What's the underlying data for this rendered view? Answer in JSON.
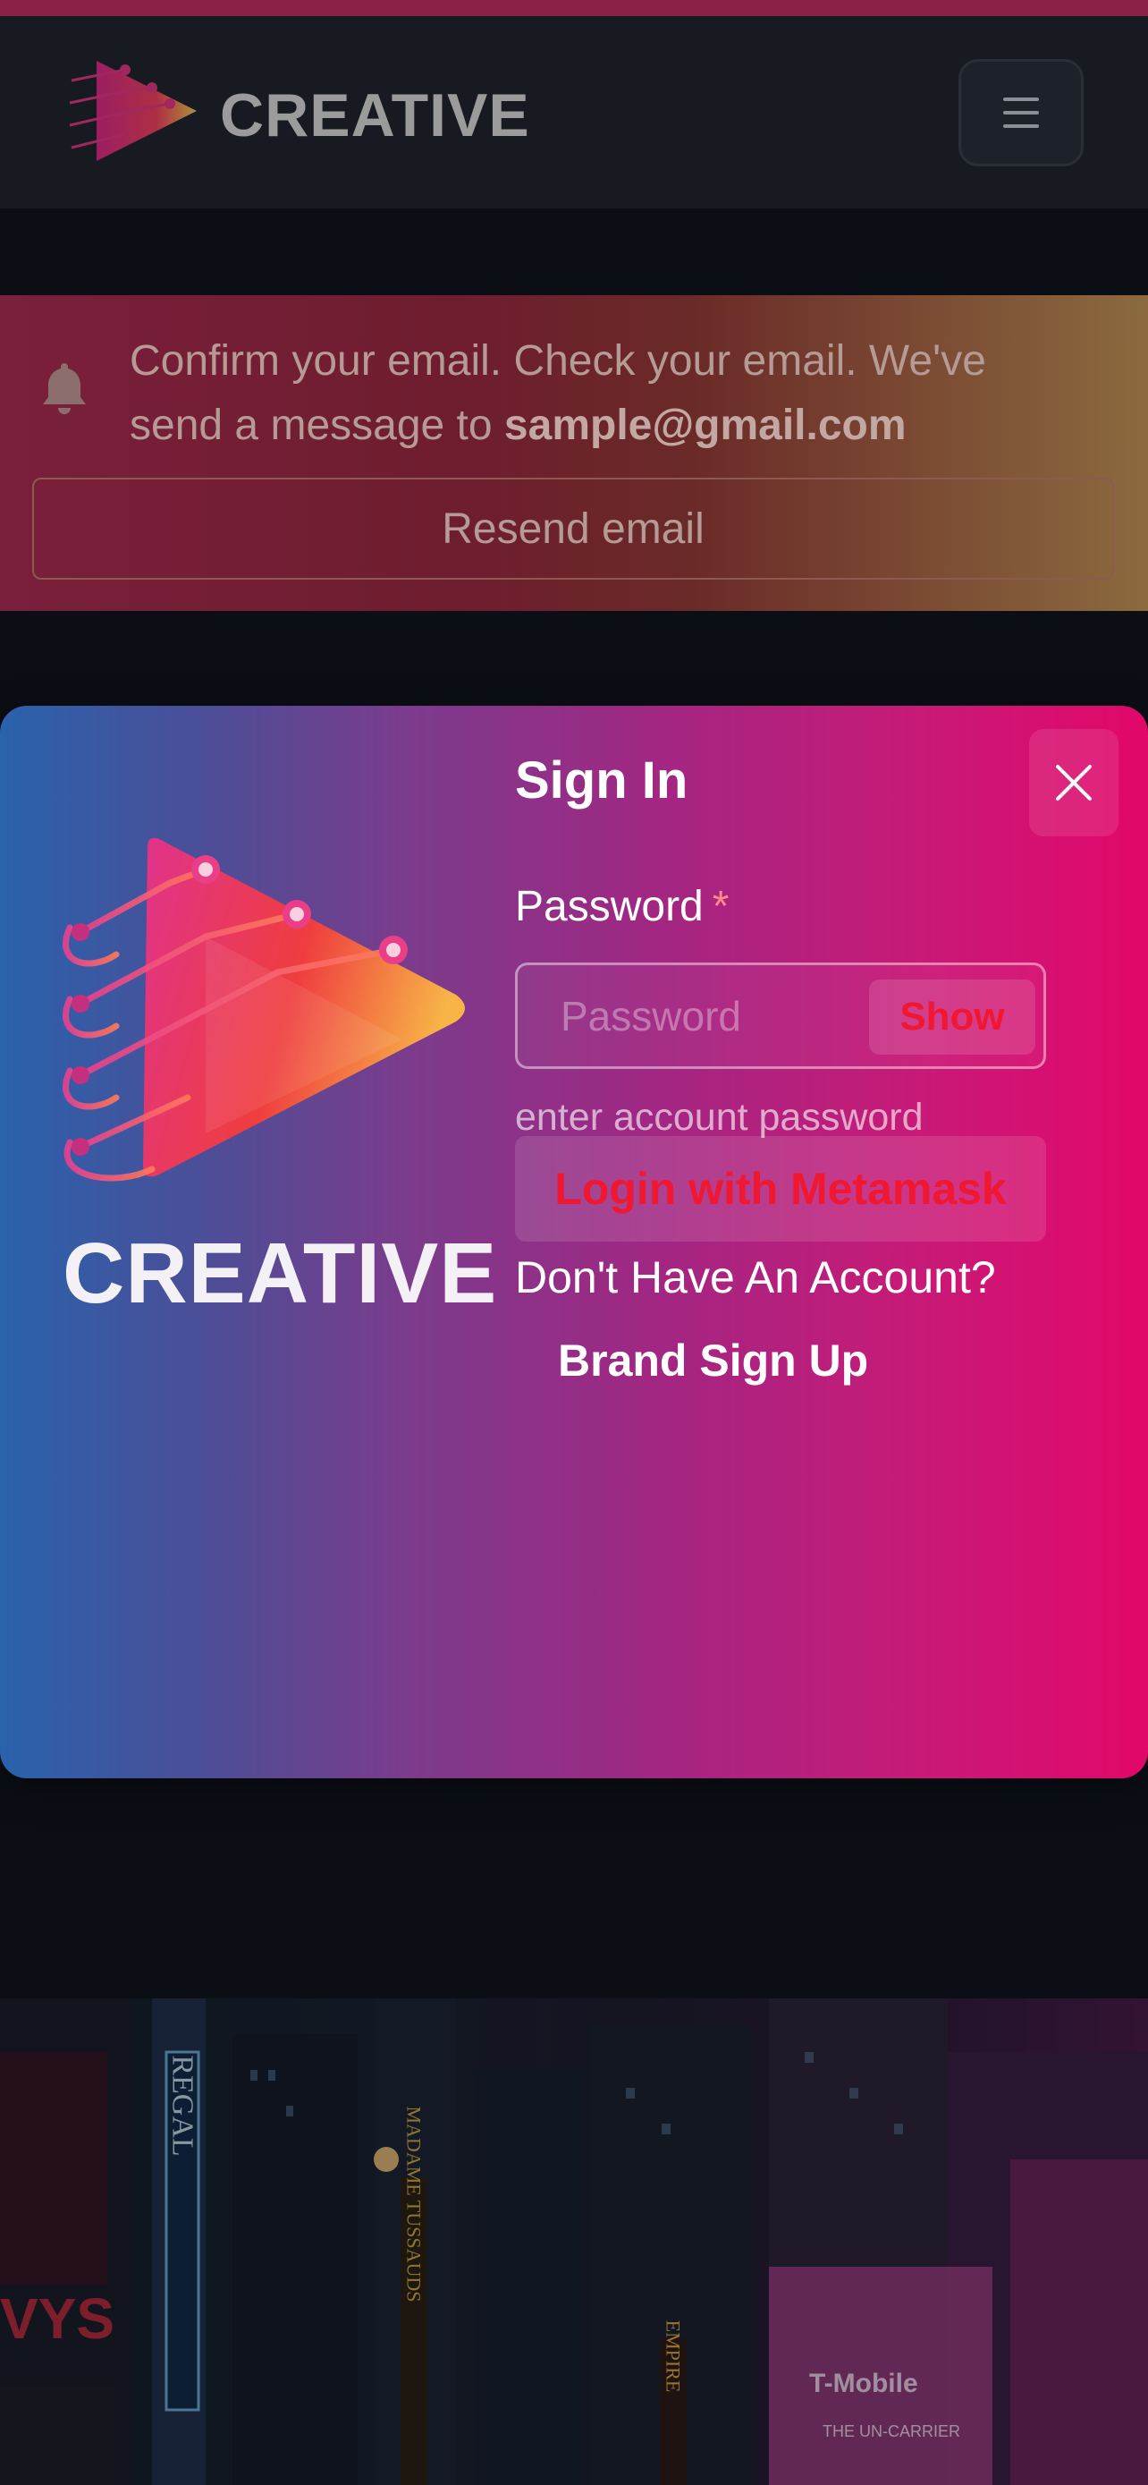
{
  "header": {
    "brand": "CREATIVE",
    "menu_icon": "hamburger-menu-icon"
  },
  "alert": {
    "icon": "bell-icon",
    "message": "Confirm your email. Check your email. We've send a message to ",
    "email": "sample@gmail.com",
    "resend_label": "Resend email"
  },
  "modal": {
    "brand": "CREATIVE",
    "title": "Sign In",
    "close_icon": "close-icon",
    "password_label": "Password",
    "required_marker": "*",
    "password_placeholder": "Password",
    "password_value": "",
    "show_label": "Show",
    "password_help": "enter account password",
    "metamask_label": "Login with Metamask",
    "no_account_text": "Don't Have An Account?",
    "signup_label": "Brand Sign Up"
  },
  "background_image": {
    "signs": [
      "REGAL",
      "MADAME TUSSAUDS",
      "EMPIRE",
      "T-Mobile",
      "THE UN-CARRIER"
    ]
  },
  "colors": {
    "modal_gradient_start": "#2a62ac",
    "modal_gradient_end": "#e2076a",
    "accent_red": "#f01730",
    "page_background": "#0b0e14"
  }
}
